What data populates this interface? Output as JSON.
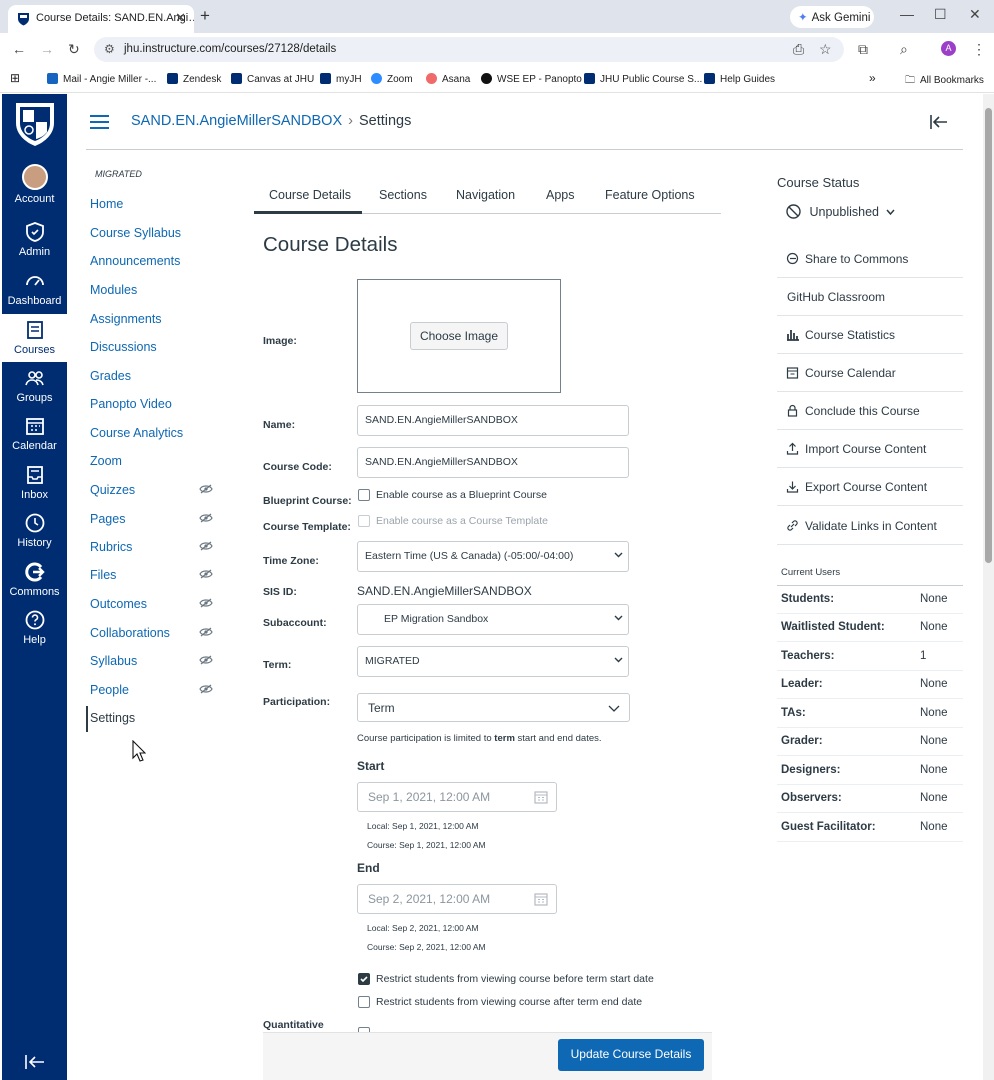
{
  "browser": {
    "tab_title": "Course Details: SAND.EN.Angi…",
    "gemini": "Ask Gemini",
    "url": "jhu.instructure.com/courses/27128/details",
    "avatar": "A",
    "bookmarks": [
      "Mail - Angie Miller -...",
      "Zendesk",
      "Canvas at JHU",
      "myJH",
      "Zoom",
      "Asana",
      "WSE EP - Panopto",
      "JHU Public Course S...",
      "Help Guides"
    ],
    "all_bookmarks": "All Bookmarks",
    "more": "»"
  },
  "global_nav": [
    "Account",
    "Admin",
    "Dashboard",
    "Courses",
    "Groups",
    "Calendar",
    "Inbox",
    "History",
    "Commons",
    "Help"
  ],
  "header": {
    "course": "SAND.EN.AngieMillerSANDBOX",
    "sep": "›",
    "current": "Settings"
  },
  "course_nav": {
    "tag": "MIGRATED",
    "items": [
      "Home",
      "Course Syllabus",
      "Announcements",
      "Modules",
      "Assignments",
      "Discussions",
      "Grades",
      "Panopto Video",
      "Course Analytics",
      "Zoom",
      "Quizzes",
      "Pages",
      "Rubrics",
      "Files",
      "Outcomes",
      "Collaborations",
      "Syllabus",
      "People",
      "Settings"
    ]
  },
  "tabs": [
    "Course Details",
    "Sections",
    "Navigation",
    "Apps",
    "Feature Options"
  ],
  "form": {
    "heading": "Course Details",
    "image_label": "Image:",
    "choose_image": "Choose Image",
    "name_label": "Name:",
    "name_value": "SAND.EN.AngieMillerSANDBOX",
    "code_label": "Course Code:",
    "code_value": "SAND.EN.AngieMillerSANDBOX",
    "blueprint_label": "Blueprint Course:",
    "blueprint_text": "Enable course as a Blueprint Course",
    "template_label": "Course Template:",
    "template_text": "Enable course as a Course Template",
    "tz_label": "Time Zone:",
    "tz_value": "Eastern Time (US & Canada) (-05:00/-04:00)",
    "sis_label": "SIS ID:",
    "sis_value": "SAND.EN.AngieMillerSANDBOX",
    "subaccount_label": "Subaccount:",
    "subaccount_value": "EP Migration Sandbox",
    "term_label": "Term:",
    "term_value": "MIGRATED",
    "participation_label": "Participation:",
    "participation_value": "Term",
    "participation_note_a": "Course participation is limited to ",
    "participation_note_b": "term",
    "participation_note_c": " start and end dates.",
    "start_label": "Start",
    "start_placeholder": "Sep 1, 2021, 12:00 AM",
    "start_local": "Local: Sep 1, 2021, 12:00 AM",
    "start_course": "Course: Sep 1, 2021, 12:00 AM",
    "end_label": "End",
    "end_placeholder": "Sep 2, 2021, 12:00 AM",
    "end_local": "Local: Sep 2, 2021, 12:00 AM",
    "end_course": "Course: Sep 2, 2021, 12:00 AM",
    "restrict_before": "Restrict students from viewing course before term start date",
    "restrict_after": "Restrict students from viewing course after term end date",
    "quant_label": "Quantitative",
    "update_button": "Update Course Details"
  },
  "sidebar": {
    "status_heading": "Course Status",
    "status_value": "Unpublished",
    "links": [
      "Share to Commons",
      "GitHub Classroom",
      "Course Statistics",
      "Course Calendar",
      "Conclude this Course",
      "Import Course Content",
      "Export Course Content",
      "Validate Links in Content"
    ],
    "users_heading": "Current Users",
    "users": [
      {
        "role": "Students:",
        "count": "None"
      },
      {
        "role": "Waitlisted Student:",
        "count": "None"
      },
      {
        "role": "Teachers:",
        "count": "1"
      },
      {
        "role": "Leader:",
        "count": "None"
      },
      {
        "role": "TAs:",
        "count": "None"
      },
      {
        "role": "Grader:",
        "count": "None"
      },
      {
        "role": "Designers:",
        "count": "None"
      },
      {
        "role": "Observers:",
        "count": "None"
      },
      {
        "role": "Guest Facilitator:",
        "count": "None"
      }
    ]
  },
  "colors": {
    "nav_bg": "#002d72",
    "link": "#0e68b3",
    "button": "#0e68b3",
    "text": "#2d3b45"
  }
}
